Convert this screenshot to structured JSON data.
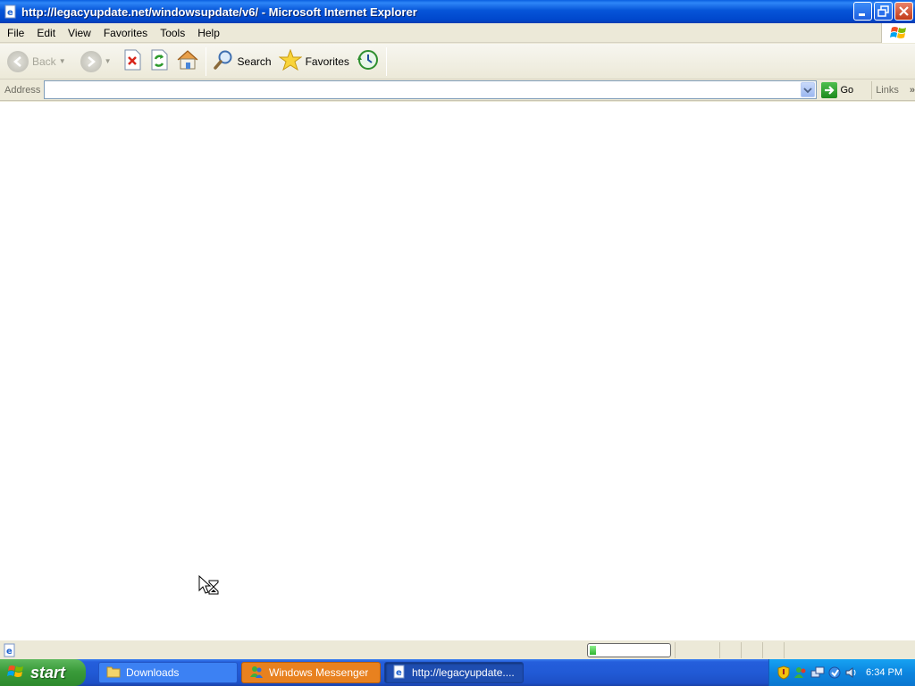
{
  "window": {
    "title": "http://legacyupdate.net/windowsupdate/v6/ - Microsoft Internet Explorer"
  },
  "menu": {
    "items": [
      "File",
      "Edit",
      "View",
      "Favorites",
      "Tools",
      "Help"
    ]
  },
  "toolbar": {
    "back_label": "Back",
    "search_label": "Search",
    "favorites_label": "Favorites"
  },
  "address": {
    "label": "Address",
    "value": "",
    "go_label": "Go",
    "links_label": "Links"
  },
  "status": {
    "text": "",
    "progress_fraction": 0.08
  },
  "taskbar": {
    "start_label": "start",
    "tasks": [
      {
        "label": "Downloads"
      },
      {
        "label": "Windows Messenger"
      },
      {
        "label": "http://legacyupdate...."
      }
    ],
    "clock": "6:34 PM"
  },
  "colors": {
    "titlebar": "#0054E3",
    "taskbar": "#245EDC",
    "start_button": "#3A9B3A",
    "content_bg": "#FFFFFF"
  }
}
